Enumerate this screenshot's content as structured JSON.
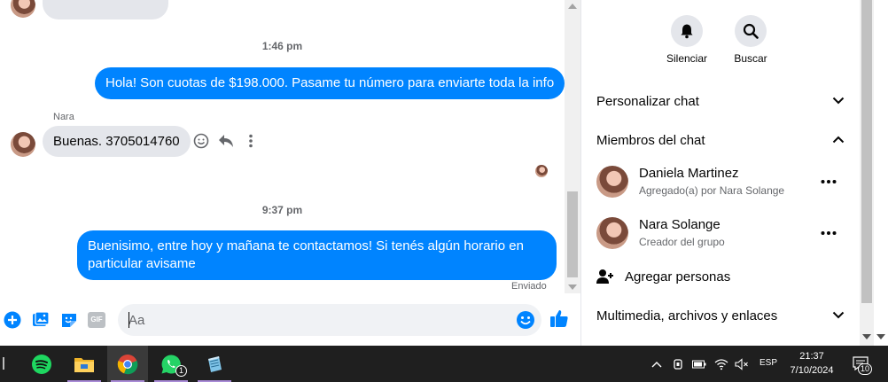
{
  "messages": {
    "time_1": "1:46 pm",
    "out_1": "Hola! Son cuotas de $198.000. Pasame tu número para enviarte toda la info",
    "sender_in_1": "Nara",
    "in_1": "Buenas. 3705014760",
    "time_2": "9:37 pm",
    "out_2": "Buenisimo, entre hoy y mañana te contactamos! Si tenés algún horario en particular avisame",
    "status": "Enviado"
  },
  "composer": {
    "placeholder": "Aa",
    "icons": [
      "plus-circle-icon",
      "photo-icon",
      "sticker-icon",
      "gif-icon",
      "emoji-icon",
      "like-icon"
    ],
    "gif_label": "GIF"
  },
  "info_panel": {
    "actions": [
      {
        "label": "Silenciar",
        "icon": "bell-icon"
      },
      {
        "label": "Buscar",
        "icon": "search-icon"
      }
    ],
    "sections": {
      "customize": "Personalizar chat",
      "members": "Miembros del chat",
      "media": "Multimedia, archivos y enlaces"
    },
    "members": [
      {
        "name": "Daniela Martinez",
        "sub": "Agregado(a) por Nara Solange"
      },
      {
        "name": "Nara Solange",
        "sub": "Creador del grupo"
      }
    ],
    "add_people": "Agregar personas"
  },
  "taskbar": {
    "apps": [
      "spotify-icon",
      "file-explorer-icon",
      "chrome-icon",
      "whatsapp-icon",
      "notepad-icon"
    ],
    "whatsapp_badge": "1",
    "language": "ESP",
    "time": "21:37",
    "date": "7/10/2024",
    "notifications_badge": "10"
  },
  "colors": {
    "accent": "#0084ff",
    "incoming_bubble": "#e4e6eb",
    "taskbar": "#1f1f1f"
  }
}
